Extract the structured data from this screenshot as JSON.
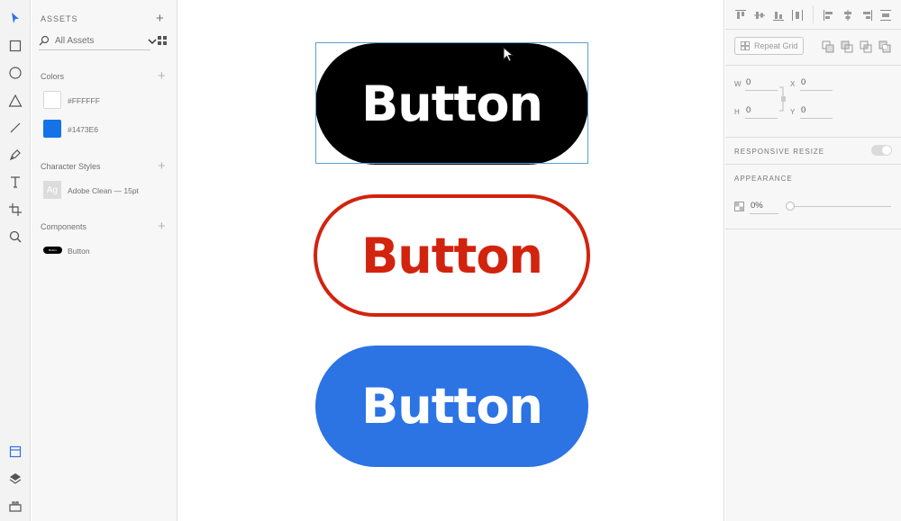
{
  "toolbar": {
    "top_tools": [
      "select-arrow-icon",
      "rectangle-icon",
      "ellipse-icon",
      "polygon-icon",
      "line-icon",
      "pen-icon",
      "text-icon",
      "artboard-icon",
      "zoom-icon"
    ],
    "bottom_tools": [
      "assets-panel-icon",
      "layers-icon",
      "plugins-icon"
    ],
    "accent": "#2c73e4"
  },
  "assets": {
    "title": "ASSETS",
    "search_value": "All Assets",
    "colors_label": "Colors",
    "colors": [
      {
        "hex": "#FFFFFF",
        "label": "#FFFFFF"
      },
      {
        "hex": "#1473E6",
        "label": "#1473E6"
      }
    ],
    "char_styles_label": "Character Styles",
    "char_style_preview": "Ag",
    "char_style_name": "Adobe Clean — 15pt",
    "components_label": "Components",
    "component_thumb": "Button",
    "component_name": "Button"
  },
  "canvas": {
    "buttons": [
      {
        "label": "Button",
        "style": "filled-black",
        "fill": "#000000",
        "text_color": "#FFFFFF"
      },
      {
        "label": "Button",
        "style": "outline-red",
        "fill": "#FFFFFF",
        "text_color": "#D2230E"
      },
      {
        "label": "Button",
        "style": "filled-blue",
        "fill": "#2C73E4",
        "text_color": "#FFFFFF"
      }
    ],
    "selection_color": "#5aa0d0"
  },
  "props": {
    "repeat_grid_label": "Repeat Grid",
    "w_label": "W",
    "w_value": "0",
    "h_label": "H",
    "h_value": "0",
    "x_label": "X",
    "x_value": "0",
    "y_label": "Y",
    "y_value": "0",
    "responsive_resize_label": "RESPONSIVE RESIZE",
    "appearance_label": "APPEARANCE",
    "opacity_value": "0%",
    "opacity_level": 0
  }
}
